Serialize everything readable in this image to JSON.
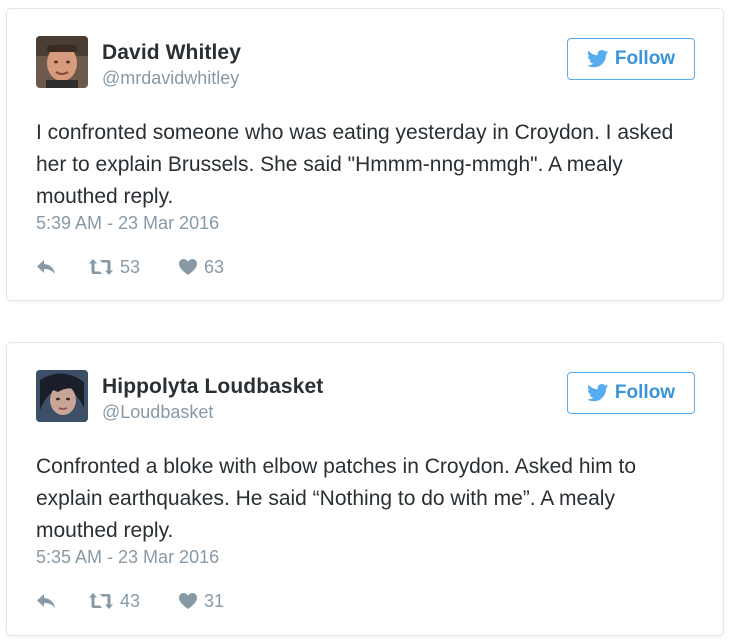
{
  "colors": {
    "accent": "#55acee",
    "text": "#292f33",
    "muted": "#8899a6",
    "border": "#e1e8ed"
  },
  "tweets": [
    {
      "author_name": "David Whitley",
      "author_handle": "@mrdavidwhitley",
      "follow_label": "Follow",
      "text": "I confronted someone who was eating yesterday in Croydon. I asked her to explain Brussels. She said \"Hmmm-nng-mmgh\". A mealy mouthed reply.",
      "timestamp": "5:39 AM - 23 Mar 2016",
      "retweets": "53",
      "likes": "63",
      "icons": [
        "twitter-bird-icon",
        "reply-icon",
        "retweet-icon",
        "heart-icon"
      ]
    },
    {
      "author_name": "Hippolyta Loudbasket",
      "author_handle": "@Loudbasket",
      "follow_label": "Follow",
      "text": "Confronted a bloke with elbow patches in Croydon. Asked him to explain earthquakes. He said “Nothing to do with me”. A mealy mouthed reply.",
      "timestamp": "5:35 AM - 23 Mar 2016",
      "retweets": "43",
      "likes": "31",
      "icons": [
        "twitter-bird-icon",
        "reply-icon",
        "retweet-icon",
        "heart-icon"
      ]
    }
  ]
}
